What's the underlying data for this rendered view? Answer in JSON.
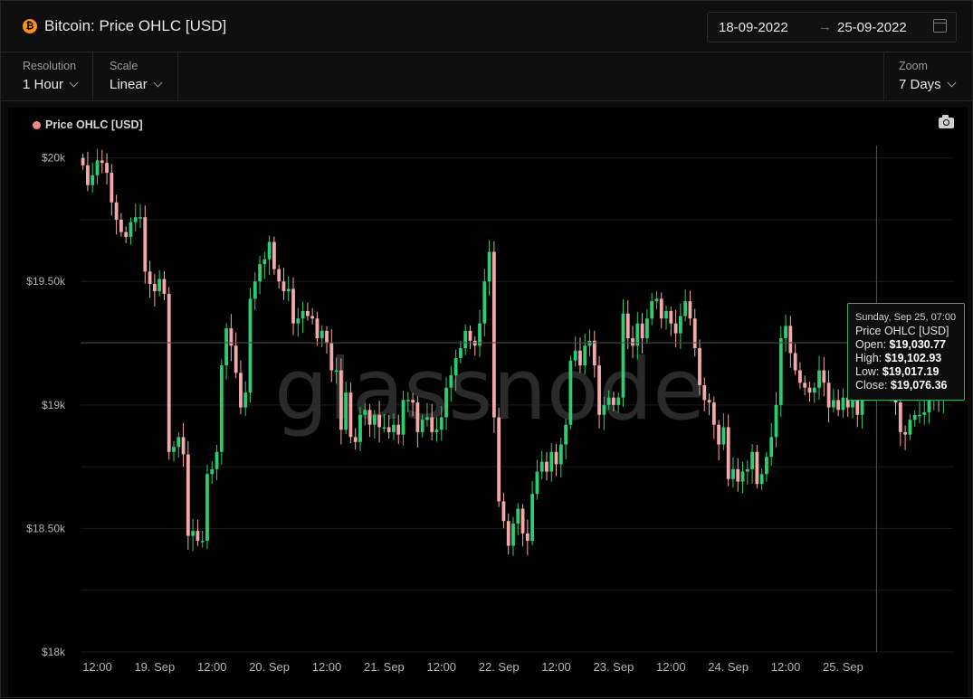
{
  "header": {
    "logo_glyph": "₿",
    "title": "Bitcoin: Price OHLC [USD]",
    "date_from": "18-09-2022",
    "date_arrow": "→",
    "date_to": "25-09-2022"
  },
  "controls": {
    "resolution_label": "Resolution",
    "resolution_value": "1 Hour",
    "scale_label": "Scale",
    "scale_value": "Linear",
    "zoom_label": "Zoom",
    "zoom_value": "7 Days"
  },
  "legend": {
    "label": "Price OHLC [USD]",
    "color": "#f08a8a"
  },
  "watermark": "glassnode",
  "tooltip": {
    "date": "Sunday, Sep 25, 07:00",
    "series": "Price OHLC [USD]",
    "open_label": "Open:",
    "open": "$19,030.77",
    "high_label": "High:",
    "high": "$19,102.93",
    "low_label": "Low:",
    "low": "$19,017.19",
    "close_label": "Close:",
    "close": "$19,076.36"
  },
  "colors": {
    "up": "#2ecc71",
    "down": "#f4a9a8",
    "grid": "#1c1c1c",
    "tooltip_border": "#27b36a"
  },
  "chart_data": {
    "type": "candlestick",
    "y_ticks": [
      {
        "value": 18000,
        "label": "$18k"
      },
      {
        "value": 18500,
        "label": "$18.50k"
      },
      {
        "value": 19000,
        "label": "$19k"
      },
      {
        "value": 19500,
        "label": "$19.50k"
      },
      {
        "value": 20000,
        "label": "$20k"
      }
    ],
    "ylim": [
      18000,
      20050
    ],
    "x_ticks": [
      {
        "t": 3,
        "label": "12:00"
      },
      {
        "t": 15,
        "label": "19. Sep"
      },
      {
        "t": 27,
        "label": "12:00"
      },
      {
        "t": 39,
        "label": "20. Sep"
      },
      {
        "t": 51,
        "label": "12:00"
      },
      {
        "t": 63,
        "label": "21. Sep"
      },
      {
        "t": 75,
        "label": "12:00"
      },
      {
        "t": 87,
        "label": "22. Sep"
      },
      {
        "t": 99,
        "label": "12:00"
      },
      {
        "t": 111,
        "label": "23. Sep"
      },
      {
        "t": 123,
        "label": "12:00"
      },
      {
        "t": 135,
        "label": "24. Sep"
      },
      {
        "t": 147,
        "label": "12:00"
      },
      {
        "t": 159,
        "label": "25. Sep"
      }
    ],
    "hover_t": 166,
    "close": [
      19970,
      19890,
      19930,
      19990,
      19980,
      19940,
      19820,
      19750,
      19700,
      19680,
      19740,
      19760,
      19760,
      19540,
      19490,
      19460,
      19510,
      19450,
      18810,
      18830,
      18870,
      18800,
      18470,
      18490,
      18450,
      18450,
      18720,
      18740,
      18810,
      19160,
      19310,
      19240,
      19130,
      18990,
      19050,
      19430,
      19500,
      19570,
      19590,
      19660,
      19550,
      19500,
      19460,
      19470,
      19330,
      19350,
      19380,
      19360,
      19350,
      19270,
      19300,
      19250,
      19140,
      19140,
      18900,
      19050,
      18870,
      18850,
      18960,
      18980,
      18920,
      18960,
      18910,
      18910,
      18890,
      18920,
      18880,
      19020,
      19020,
      19010,
      18890,
      18940,
      18950,
      18890,
      18900,
      18950,
      19070,
      19120,
      19190,
      19230,
      19300,
      19260,
      19240,
      19330,
      19500,
      19620,
      18950,
      18610,
      18530,
      18430,
      18520,
      18580,
      18480,
      18450,
      18640,
      18730,
      18770,
      18730,
      18810,
      18760,
      18840,
      18920,
      19180,
      19220,
      19160,
      19240,
      19260,
      19160,
      18960,
      19000,
      19030,
      19000,
      19030,
      19370,
      19270,
      19240,
      19330,
      19270,
      19350,
      19420,
      19430,
      19350,
      19380,
      19330,
      19290,
      19360,
      19420,
      19350,
      19230,
      19080,
      19020,
      19010,
      18920,
      18840,
      18910,
      18700,
      18740,
      18690,
      18730,
      18740,
      18810,
      18680,
      18720,
      18790,
      18870,
      19000,
      19270,
      19320,
      19210,
      19140,
      19090,
      19070,
      19050,
      19070,
      19140,
      19090,
      18990,
      19020,
      18980,
      19030,
      18990,
      19070,
      18960,
      19100,
      19080,
      19110,
      19070,
      19080,
      19060,
      19080,
      19010,
      18890,
      18880,
      18940,
      18960,
      18960,
      18970,
      19030,
      19050,
      19030,
      19076.36
    ]
  }
}
